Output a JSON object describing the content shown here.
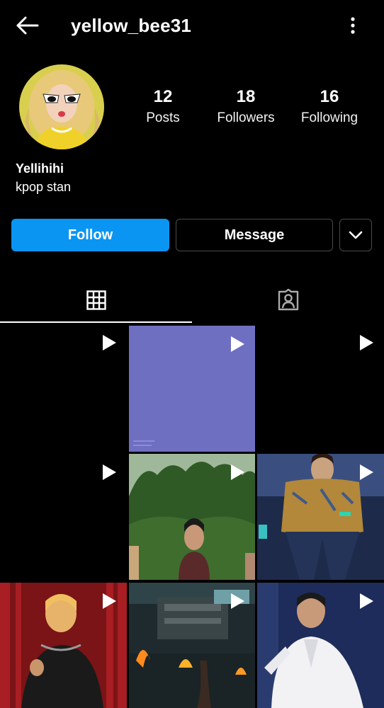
{
  "header": {
    "username": "yellow_bee31",
    "back_icon": "arrow-left-icon",
    "more_icon": "more-vertical-icon"
  },
  "profile": {
    "avatar_icon": "profile-avatar",
    "stats": {
      "posts": {
        "value": "12",
        "label": "Posts"
      },
      "followers": {
        "value": "18",
        "label": "Followers"
      },
      "following": {
        "value": "16",
        "label": "Following"
      }
    },
    "display_name": "Yellihihi",
    "bio": "kpop stan"
  },
  "actions": {
    "follow_label": "Follow",
    "message_label": "Message",
    "dropdown_icon": "chevron-down-icon"
  },
  "tabs": {
    "grid_icon": "grid-icon",
    "tagged_icon": "tagged-person-icon",
    "active": "grid"
  },
  "colors": {
    "background": "#000000",
    "follow_button": "#0a95f3",
    "tile_purple": "#6f6fc2",
    "border": "#4a4a4a"
  },
  "grid": {
    "tiles": [
      {
        "kind": "video",
        "thumb": "black"
      },
      {
        "kind": "video",
        "thumb": "purple"
      },
      {
        "kind": "video",
        "thumb": "black"
      },
      {
        "kind": "video",
        "thumb": "black"
      },
      {
        "kind": "video",
        "thumb": "forest-woman"
      },
      {
        "kind": "video",
        "thumb": "stage-dancer"
      },
      {
        "kind": "video",
        "thumb": "red-curtain-man"
      },
      {
        "kind": "video",
        "thumb": "fire-building"
      },
      {
        "kind": "video",
        "thumb": "white-shirt-dancer"
      }
    ]
  }
}
